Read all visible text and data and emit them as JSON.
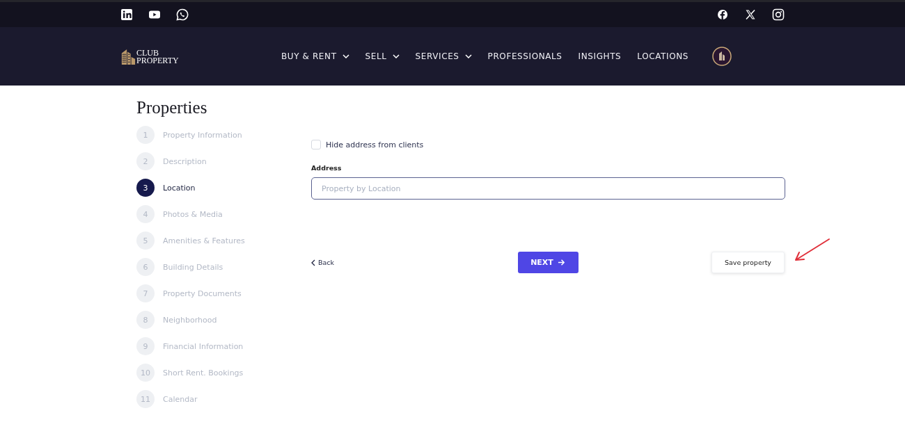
{
  "topbar": {
    "social_left": [
      {
        "kind": "linkedin"
      },
      {
        "kind": "youtube"
      },
      {
        "kind": "whatsapp"
      }
    ],
    "social_right": [
      {
        "kind": "facebook"
      },
      {
        "kind": "x"
      },
      {
        "kind": "instagram"
      }
    ]
  },
  "navbar": {
    "logo": [
      "CLUB",
      "PROPERTY"
    ],
    "items": [
      {
        "label": "BUY & RENT",
        "dropdown": true
      },
      {
        "label": "SELL",
        "dropdown": true
      },
      {
        "label": "SERVICES",
        "dropdown": true
      },
      {
        "label": "PROFESSIONALS",
        "dropdown": false
      },
      {
        "label": "INSIGHTS",
        "dropdown": false
      },
      {
        "label": "LOCATIONS",
        "dropdown": false
      }
    ]
  },
  "page_title": "Properties",
  "steps": [
    {
      "number": "1",
      "label": "Property Information",
      "selected": false
    },
    {
      "number": "2",
      "label": "Description",
      "selected": false
    },
    {
      "number": "3",
      "label": "Location",
      "selected": true
    },
    {
      "number": "4",
      "label": "Photos & Media",
      "selected": false
    },
    {
      "number": "5",
      "label": "Amenities & Features",
      "selected": false
    },
    {
      "number": "6",
      "label": "Building Details",
      "selected": false
    },
    {
      "number": "7",
      "label": "Property Documents",
      "selected": false
    },
    {
      "number": "8",
      "label": "Neighborhood",
      "selected": false
    },
    {
      "number": "9",
      "label": "Financial Information",
      "selected": false
    },
    {
      "number": "10",
      "label": "Short Rent. Bookings",
      "selected": false
    },
    {
      "number": "11",
      "label": "Calendar",
      "selected": false
    }
  ],
  "form": {
    "hide_address": {
      "label": "Hide address from clients",
      "checked": false
    },
    "address": {
      "label": "Address",
      "placeholder": "Property by Location"
    },
    "back": "Back",
    "next": "NEXT",
    "save": "Save property"
  }
}
